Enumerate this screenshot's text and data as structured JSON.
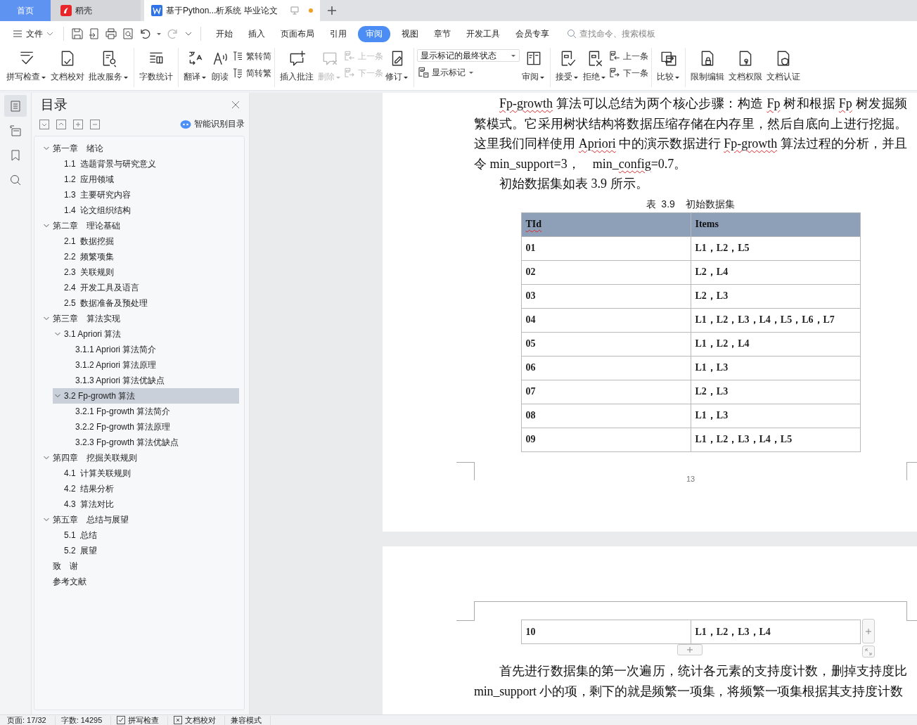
{
  "tabs": [
    {
      "label": "首页",
      "kind": "home",
      "selected": false
    },
    {
      "label": "稻壳",
      "kind": "app",
      "selected": false
    },
    {
      "label": "基于Python...析系统 毕业论文",
      "kind": "doc",
      "selected": true,
      "modified": true
    }
  ],
  "menu": {
    "file": "文件",
    "ribbon_tabs": [
      {
        "label": "开始",
        "selected": false
      },
      {
        "label": "插入",
        "selected": false
      },
      {
        "label": "页面布局",
        "selected": false
      },
      {
        "label": "引用",
        "selected": false
      },
      {
        "label": "审阅",
        "selected": true
      },
      {
        "label": "视图",
        "selected": false
      },
      {
        "label": "章节",
        "selected": false
      },
      {
        "label": "开发工具",
        "selected": false
      },
      {
        "label": "会员专享",
        "selected": false
      }
    ],
    "search": {
      "placeholder": "查找命令、搜索模板"
    }
  },
  "ribbon": [
    [
      {
        "kind": "big",
        "label": "拼写检查",
        "dropdown": true,
        "disabled": false
      },
      {
        "kind": "big",
        "label": "文档校对",
        "dropdown": false,
        "disabled": false
      },
      {
        "kind": "big",
        "label": "批改服务",
        "dropdown": true,
        "disabled": false
      }
    ],
    [
      {
        "kind": "big",
        "label": "字数统计",
        "dropdown": false,
        "disabled": false
      }
    ],
    [
      {
        "kind": "big",
        "label": "翻译",
        "dropdown": true,
        "disabled": false
      },
      {
        "kind": "big",
        "label": "朗读",
        "dropdown": false,
        "disabled": false
      },
      {
        "kind": "stack",
        "items": [
          {
            "label": "繁转简",
            "disabled": false
          },
          {
            "label": "简转繁",
            "disabled": false
          }
        ]
      }
    ],
    [
      {
        "kind": "big",
        "label": "插入批注",
        "dropdown": false,
        "disabled": false
      },
      {
        "kind": "big",
        "label": "删除",
        "dropdown": true,
        "disabled": true
      },
      {
        "kind": "stack",
        "items": [
          {
            "label": "上一条",
            "disabled": true
          },
          {
            "label": "下一条",
            "disabled": true
          }
        ]
      },
      {
        "kind": "big",
        "label": "修订",
        "dropdown": true,
        "disabled": false
      }
    ],
    [
      {
        "kind": "select",
        "value": "显示标记的最终状态",
        "button": {
          "label": "显示标记",
          "dropdown": true
        }
      },
      {
        "kind": "big",
        "label": "审阅",
        "dropdown": true,
        "disabled": false
      }
    ],
    [
      {
        "kind": "big",
        "label": "接受",
        "dropdown": true,
        "disabled": false
      },
      {
        "kind": "big",
        "label": "拒绝",
        "dropdown": true,
        "disabled": false
      },
      {
        "kind": "stack",
        "items": [
          {
            "label": "上一条",
            "disabled": false
          },
          {
            "label": "下一条",
            "disabled": false
          }
        ]
      }
    ],
    [
      {
        "kind": "big",
        "label": "比较",
        "dropdown": true,
        "disabled": false
      }
    ],
    [
      {
        "kind": "big",
        "label": "限制编辑",
        "dropdown": false,
        "disabled": false
      },
      {
        "kind": "big",
        "label": "文档权限",
        "dropdown": false,
        "disabled": false
      },
      {
        "kind": "big",
        "label": "文档认证",
        "dropdown": false,
        "disabled": false
      }
    ]
  ],
  "sidebar": {
    "nav": [
      {
        "selected": true
      },
      {
        "selected": false
      },
      {
        "selected": false
      },
      {
        "selected": false
      }
    ],
    "title": "目录",
    "smart_button": "智能识别目录",
    "toc": [
      {
        "label": "第一章　绪论",
        "expanded": true,
        "selected": false,
        "children": [
          {
            "label": "1.1  选题背景与研究意义",
            "selected": false
          },
          {
            "label": "1.2  应用领域",
            "selected": false
          },
          {
            "label": "1.3  主要研究内容",
            "selected": false
          },
          {
            "label": "1.4  论文组织结构",
            "selected": false
          }
        ]
      },
      {
        "label": "第二章　理论基础",
        "expanded": true,
        "selected": false,
        "children": [
          {
            "label": "2.1  数据挖掘",
            "selected": false
          },
          {
            "label": "2.2  频繁项集",
            "selected": false
          },
          {
            "label": "2.3  关联规则",
            "selected": false
          },
          {
            "label": "2.4  开发工具及语言",
            "selected": false
          },
          {
            "label": "2.5  数据准备及预处理",
            "selected": false
          }
        ]
      },
      {
        "label": "第三章　算法实现",
        "expanded": true,
        "selected": false,
        "children": [
          {
            "label": "3.1 Apriori 算法",
            "expanded": true,
            "selected": false,
            "children": [
              {
                "label": "3.1.1 Apriori 算法简介",
                "selected": false
              },
              {
                "label": "3.1.2 Apriori 算法原理",
                "selected": false
              },
              {
                "label": "3.1.3 Apriori 算法优缺点",
                "selected": false
              }
            ]
          },
          {
            "label": "3.2 Fp-growth 算法",
            "expanded": true,
            "selected": true,
            "children": [
              {
                "label": "3.2.1 Fp-growth 算法简介",
                "selected": false
              },
              {
                "label": "3.2.2 Fp-growth 算法原理",
                "selected": false
              },
              {
                "label": "3.2.3 Fp-growth 算法优缺点",
                "selected": false
              }
            ]
          }
        ]
      },
      {
        "label": "第四章　挖掘关联规则",
        "expanded": true,
        "selected": false,
        "children": [
          {
            "label": "4.1  计算关联规则",
            "selected": false
          },
          {
            "label": "4.2  结果分析",
            "selected": false
          },
          {
            "label": "4.3  算法对比",
            "selected": false
          }
        ]
      },
      {
        "label": "第五章　总结与展望",
        "expanded": true,
        "selected": false,
        "children": [
          {
            "label": "5.1  总结",
            "selected": false
          },
          {
            "label": "5.2  展望",
            "selected": false
          }
        ]
      },
      {
        "label": "致　谢",
        "selected": false
      },
      {
        "label": "参考文献",
        "selected": false
      }
    ]
  },
  "document": {
    "paragraphs": [
      {
        "runs": [
          {
            "text": "Fp-growth",
            "spell_error": true
          },
          {
            "text": " 算法可以总结为两个核心步骤：构造 ",
            "spell_error": false
          },
          {
            "text": "Fp",
            "spell_error": true
          },
          {
            "text": " 树和根据 ",
            "spell_error": false
          },
          {
            "text": "Fp",
            "spell_error": true
          },
          {
            "text": " 树发掘频繁模式。它采用树状结构将数据压缩存储在内存里，然后自底向上进行挖掘。这里我们同样使用 ",
            "spell_error": false
          },
          {
            "text": "Apriori",
            "spell_error": true
          },
          {
            "text": " 中的演示数据进行 ",
            "spell_error": false
          },
          {
            "text": "Fp-growth",
            "spell_error": true
          },
          {
            "text": " 算法过程的分析，并且令 min_support=3，　min_",
            "spell_error": false
          },
          {
            "text": "config",
            "spell_error": true
          },
          {
            "text": "=0.7。",
            "spell_error": false
          }
        ]
      },
      {
        "runs": [
          {
            "text": "初始数据集如表 3.9 所示。",
            "spell_error": false
          }
        ]
      }
    ],
    "table_caption": "表  3.9    初始数据集",
    "table": {
      "columns": [
        "TId",
        "Items"
      ],
      "rows": [
        [
          "01",
          "L1，L2，L5"
        ],
        [
          "02",
          "L2，L4"
        ],
        [
          "03",
          "L2，L3"
        ],
        [
          "04",
          "L1，L2，L3，L4，L5，L6，L7"
        ],
        [
          "05",
          "L1，L2，L4"
        ],
        [
          "06",
          "L1，L3"
        ],
        [
          "07",
          "L2，L3"
        ],
        [
          "08",
          "L1，L3"
        ],
        [
          "09",
          "L1，L2，L3，L4，L5"
        ]
      ]
    },
    "page_number": "13",
    "next_page_rows": [
      [
        "10",
        "L1，L2，L3，L4"
      ]
    ],
    "next_page_paragraphs": [
      {
        "runs": [
          {
            "text": "首先进行数据集的第一次遍历，统计各元素的支持度计数，删掉支持度比 min_support 小的项，剩下的就是频繁一项集，将频繁一项集根据其支持度计数",
            "spell_error": false
          }
        ]
      }
    ]
  },
  "status_bar": [
    {
      "kind": "text",
      "label": "页面: 17/32"
    },
    {
      "kind": "text",
      "label": "字数: 14295"
    },
    {
      "kind": "check",
      "label": "拼写检查",
      "checked": true
    },
    {
      "kind": "check",
      "label": "文档校对",
      "checked": false
    },
    {
      "kind": "text",
      "label": "兼容模式"
    }
  ]
}
